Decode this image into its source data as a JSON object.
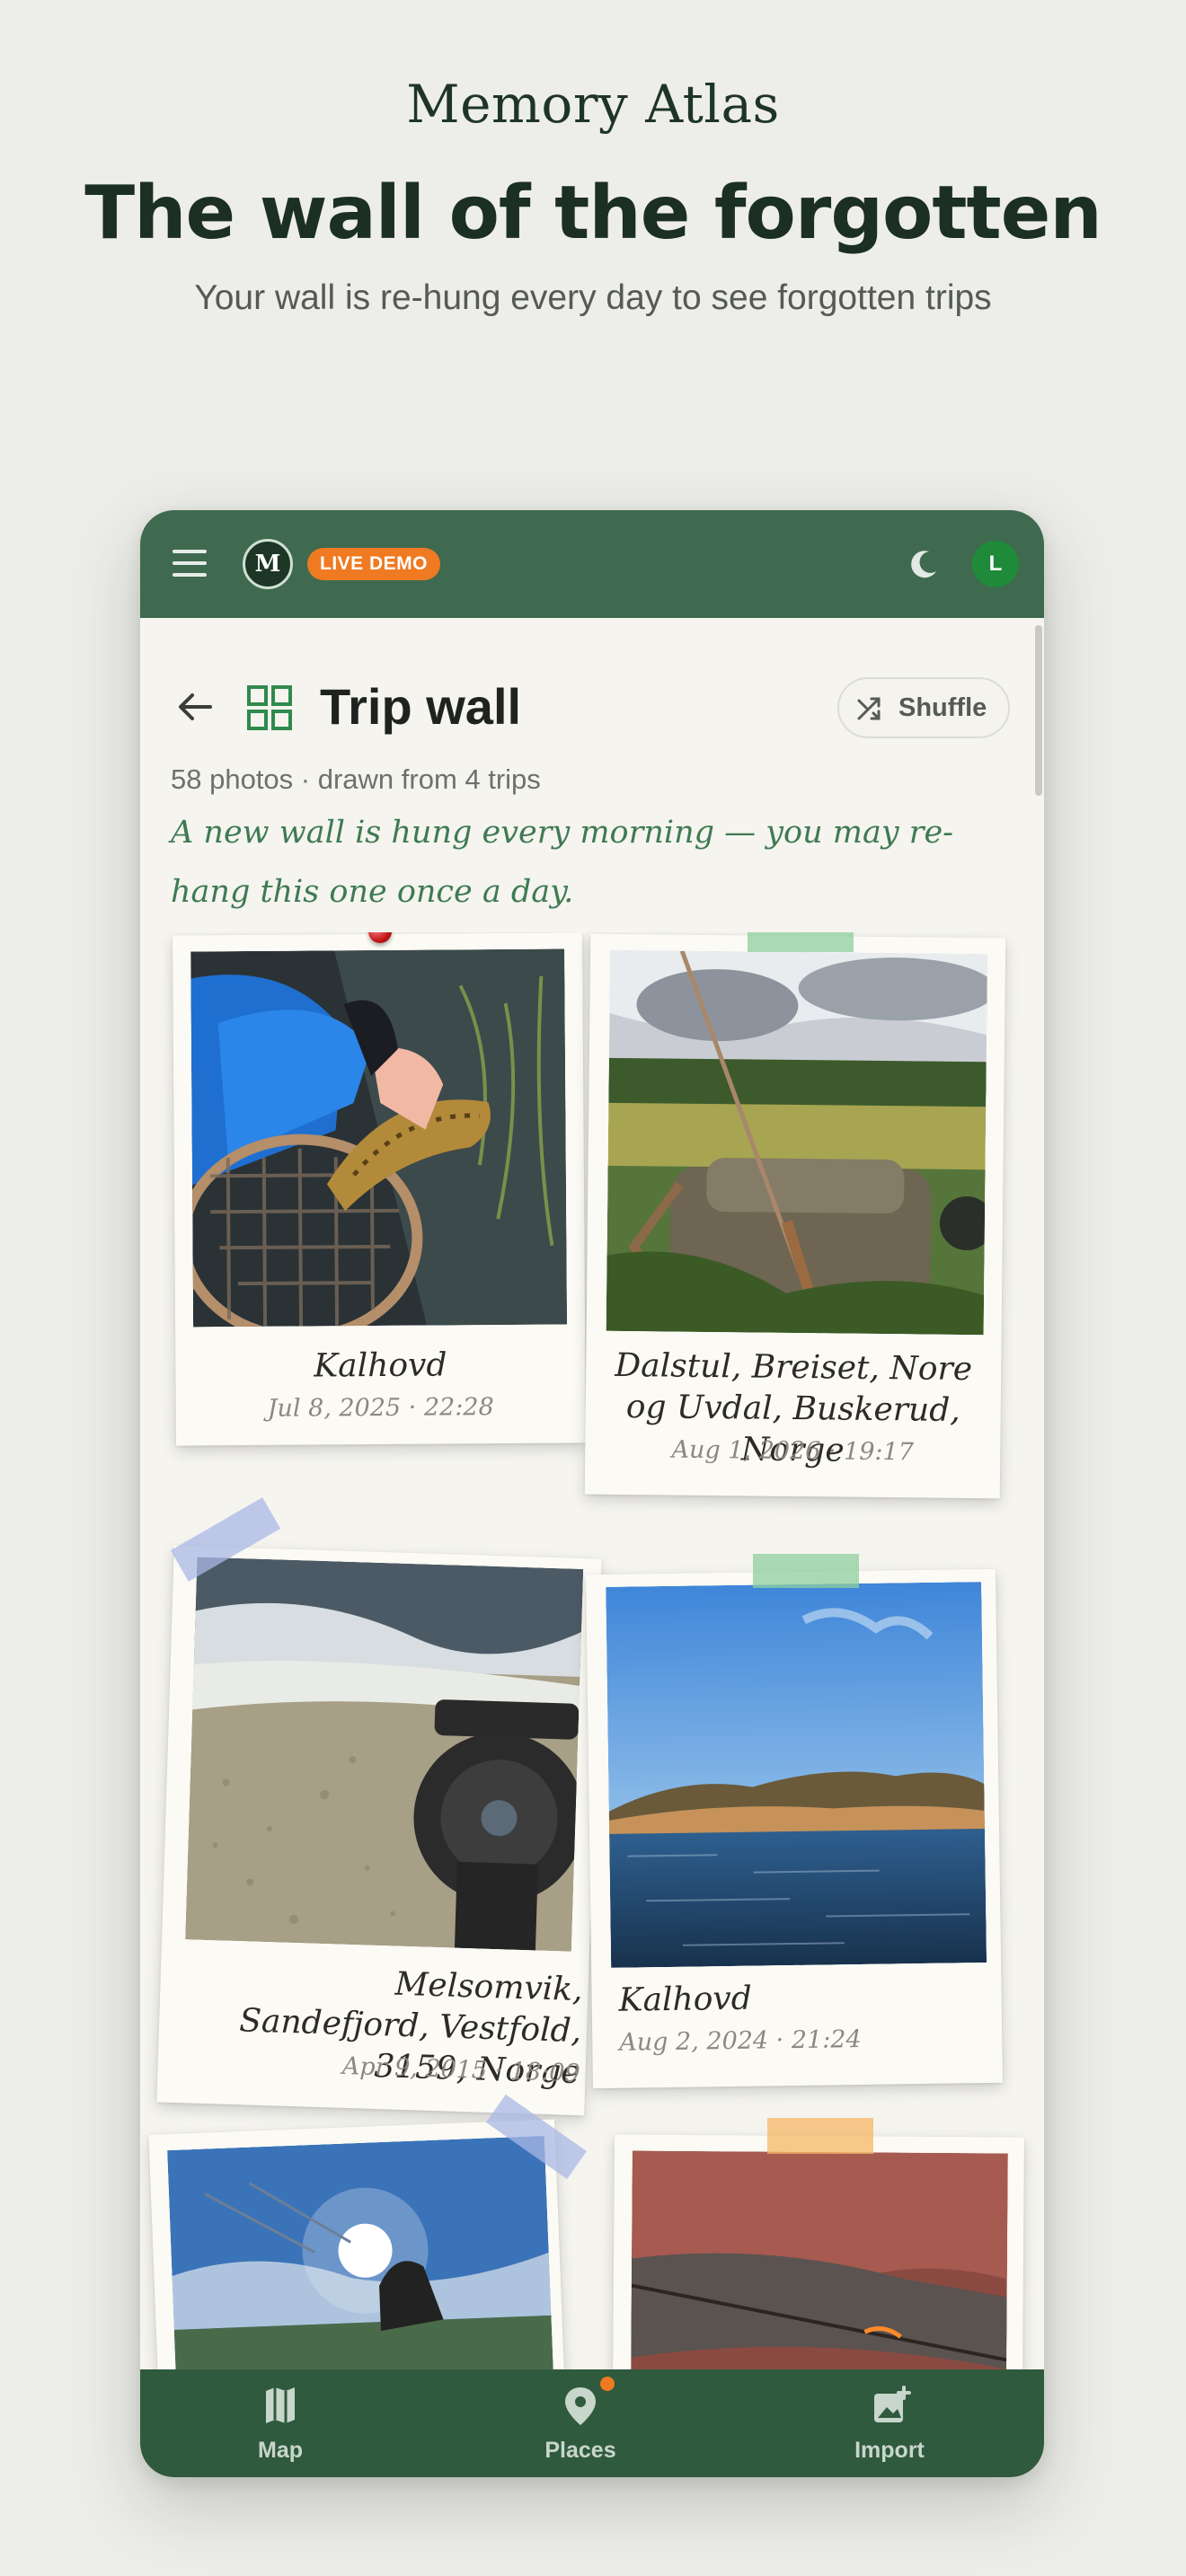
{
  "hero": {
    "brand": "Memory Atlas",
    "headline": "The wall of the forgotten",
    "subline": "Your wall is re-hung every day to see forgotten trips"
  },
  "topbar": {
    "logo_text": "M",
    "badge": "LIVE DEMO",
    "avatar_initial": "L",
    "colors": {
      "bar": "#3f6a4f",
      "badge": "#ef7a22",
      "avatar": "#1f8a3a"
    }
  },
  "page": {
    "title": "Trip wall",
    "shuffle_label": "Shuffle",
    "meta": "58 photos · drawn from 4 trips",
    "note": "A new wall is hung every morning — you may re-hang this one once a day."
  },
  "photos": [
    {
      "place": "Kalhovd",
      "date": "Jul 8, 2025 · 22:28"
    },
    {
      "place": "Dalstul, Breiset, Nore og Uvdal, Buskerud, Norge",
      "date": "Aug 1, 2026 · 19:17"
    },
    {
      "place": "Melsomvik, Sandefjord, Vestfold, 3159, Norge",
      "date": "Apr 9, 2015 · 18:09"
    },
    {
      "place": "Kalhovd",
      "date": "Aug 2, 2024 · 21:24"
    },
    {
      "place": "",
      "date": ""
    },
    {
      "place": "",
      "date": ""
    }
  ],
  "nav": {
    "items": [
      {
        "label": "Map",
        "icon": "map-icon"
      },
      {
        "label": "Places",
        "icon": "pin-icon"
      },
      {
        "label": "Import",
        "icon": "add-photo-icon"
      }
    ]
  }
}
